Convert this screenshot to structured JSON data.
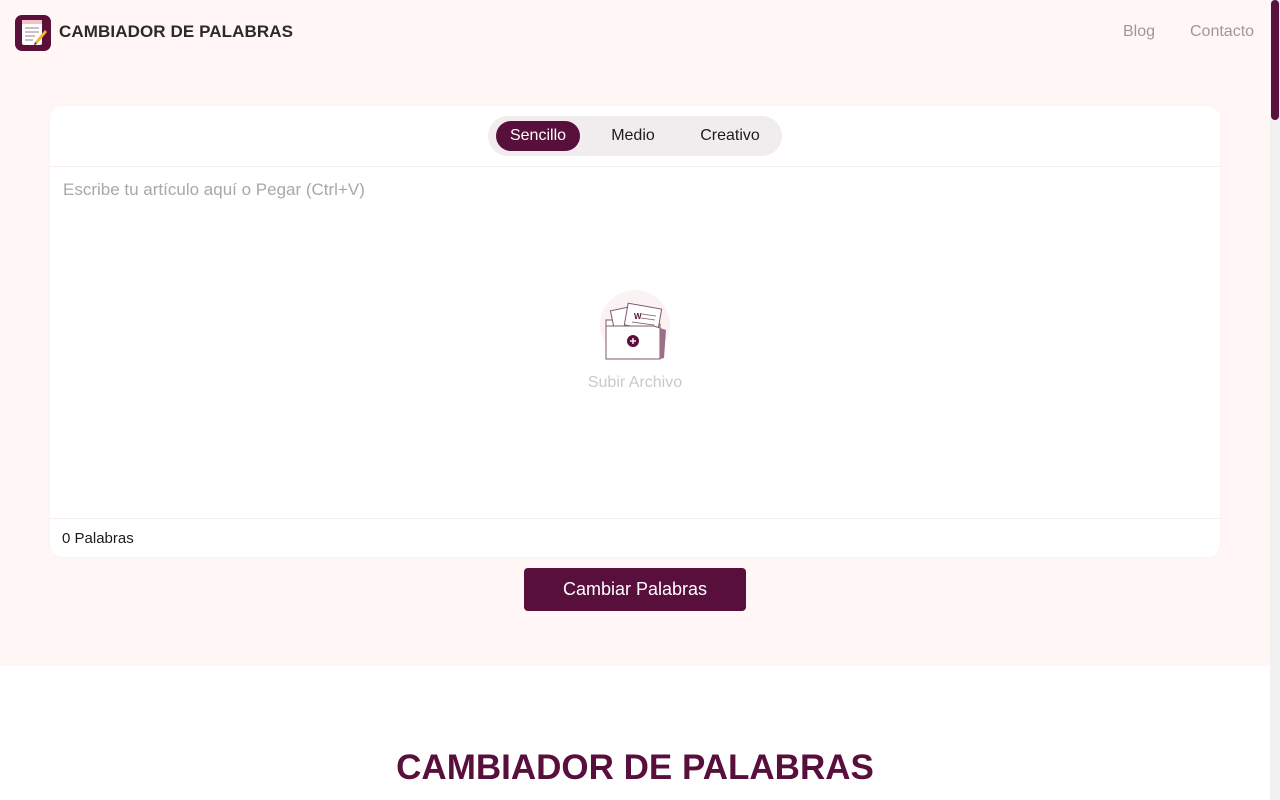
{
  "header": {
    "logo_icon": "notepad-pencil-icon",
    "brand": "CAMBIADOR DE PALABRAS",
    "nav": [
      {
        "label": "Blog"
      },
      {
        "label": "Contacto"
      }
    ]
  },
  "editor": {
    "modes": [
      {
        "label": "Sencillo",
        "active": true
      },
      {
        "label": "Medio",
        "active": false
      },
      {
        "label": "Creativo",
        "active": false
      }
    ],
    "placeholder": "Escribe tu artículo aquí o Pegar (Ctrl+V)",
    "value": "",
    "upload_icon": "document-folder-upload-icon",
    "upload_label": "Subir Archivo",
    "word_count": "0 Palabras"
  },
  "cta": {
    "label": "Cambiar Palabras"
  },
  "section": {
    "title": "CAMBIADOR DE PALABRAS"
  },
  "colors": {
    "accent": "#580f3c",
    "hero_background": "#fff6f5",
    "placeholder_text": "#a8a8a8"
  }
}
